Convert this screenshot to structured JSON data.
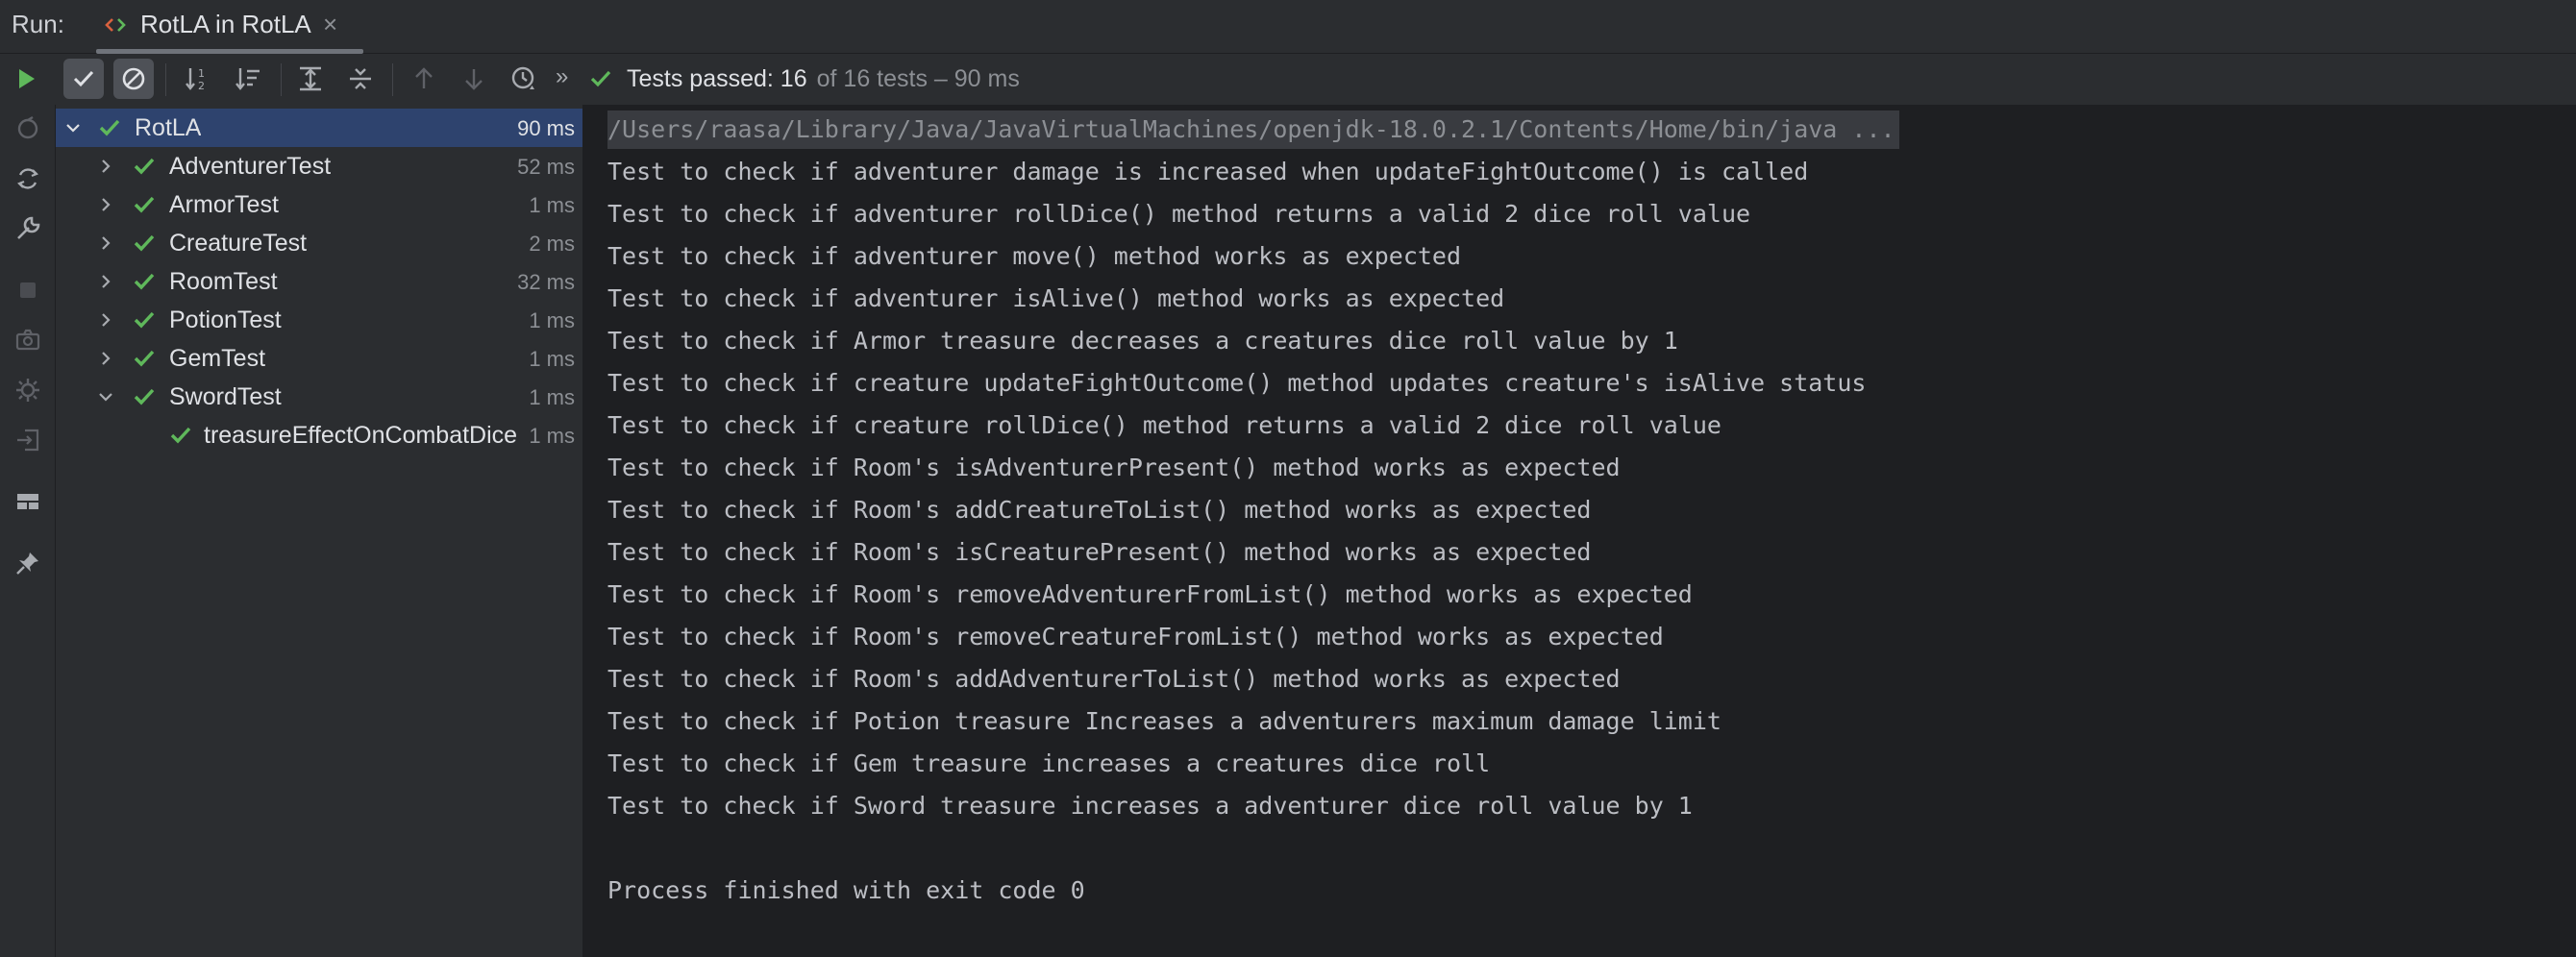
{
  "run_bar": {
    "label": "Run:",
    "tab_title": "RotLA in RotLA",
    "tab_close": "×"
  },
  "toolbar": {
    "more": "»",
    "status_passed": "Tests passed: 16",
    "status_total": "of 16 tests – 90 ms",
    "colors": {
      "success": "#5fb85b",
      "run": "#5fb85b"
    }
  },
  "tree": {
    "rows": [
      {
        "name": "RotLA",
        "time": "90 ms"
      },
      {
        "name": "AdventurerTest",
        "time": "52 ms"
      },
      {
        "name": "ArmorTest",
        "time": "1 ms"
      },
      {
        "name": "CreatureTest",
        "time": "2 ms"
      },
      {
        "name": "RoomTest",
        "time": "32 ms"
      },
      {
        "name": "PotionTest",
        "time": "1 ms"
      },
      {
        "name": "GemTest",
        "time": "1 ms"
      },
      {
        "name": "SwordTest",
        "time": "1 ms"
      },
      {
        "name": "treasureEffectOnCombatDice",
        "time": "1 ms"
      }
    ]
  },
  "console": {
    "command": "/Users/raasa/Library/Java/JavaVirtualMachines/openjdk-18.0.2.1/Contents/Home/bin/java ...",
    "lines": [
      "Test to check if adventurer damage is increased when updateFightOutcome() is called",
      "Test to check if adventurer rollDice() method returns a valid 2 dice roll value",
      "Test to check if adventurer move() method works as expected",
      "Test to check if adventurer isAlive() method works as expected",
      "Test to check if Armor treasure decreases a creatures dice roll value by 1",
      "Test to check if creature updateFightOutcome() method updates creature's isAlive status",
      "Test to check if creature rollDice() method returns a valid 2 dice roll value",
      "Test to check if Room's isAdventurerPresent() method works as expected",
      "Test to check if Room's addCreatureToList() method works as expected",
      "Test to check if Room's isCreaturePresent() method works as expected",
      "Test to check if Room's removeAdventurerFromList() method works as expected",
      "Test to check if Room's removeCreatureFromList() method works as expected",
      "Test to check if Room's addAdventurerToList() method works as expected",
      "Test to check if Potion treasure Increases a adventurers maximum damage limit",
      "Test to check if Gem treasure increases a creatures dice roll",
      "Test to check if Sword treasure increases a adventurer dice roll value by 1"
    ],
    "exit": "Process finished with exit code 0"
  }
}
